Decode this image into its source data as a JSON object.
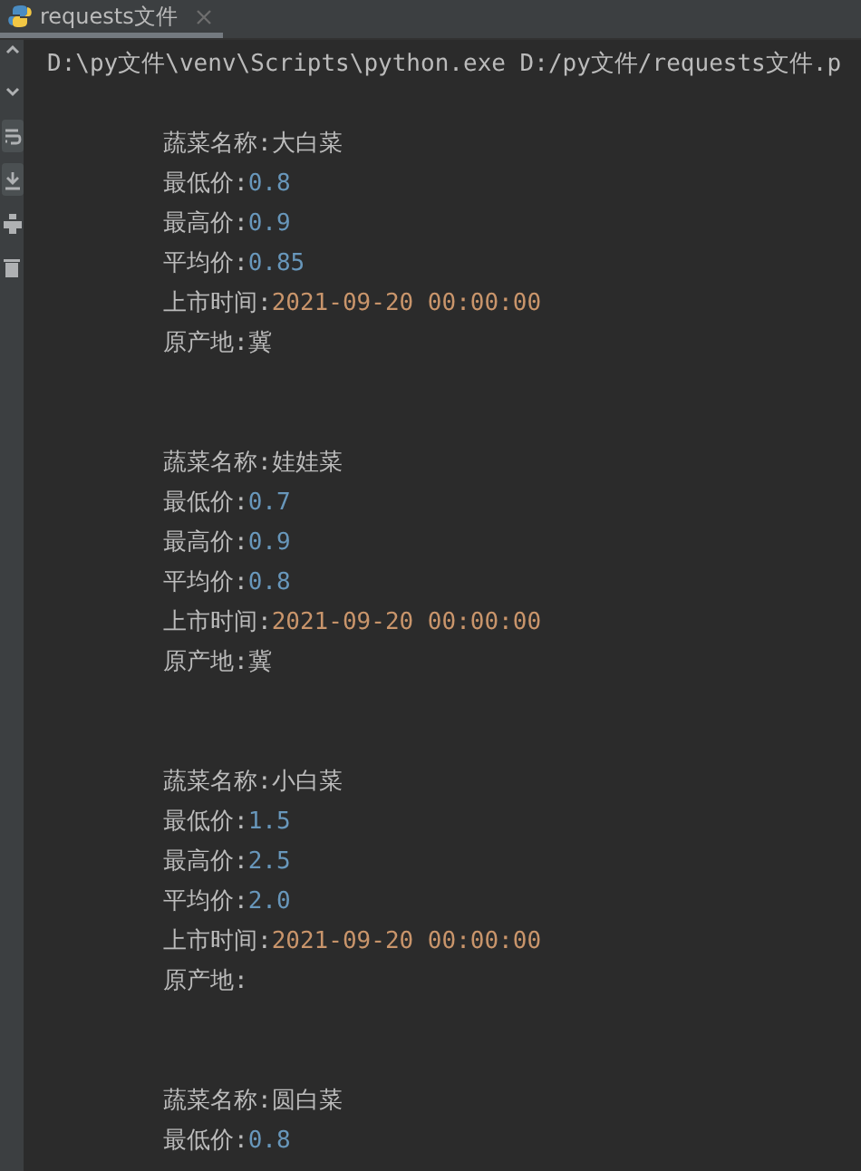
{
  "tab": {
    "title": "requests文件",
    "selected": true
  },
  "toolbar": [
    {
      "kind": "up",
      "on": false
    },
    {
      "kind": "down",
      "on": false
    },
    {
      "kind": "wrap",
      "on": true
    },
    {
      "kind": "scroll",
      "on": true
    },
    {
      "kind": "print",
      "on": false
    },
    {
      "kind": "trash",
      "on": false
    }
  ],
  "console": {
    "command": "D:\\py文件\\venv\\Scripts\\python.exe D:/py文件/requests文件.p",
    "records": [
      {
        "lines": [
          {
            "label": "蔬菜名称:",
            "value": "大白菜",
            "kind": "text"
          },
          {
            "label": "最低价:",
            "value": "0.8",
            "kind": "number"
          },
          {
            "label": "最高价:",
            "value": "0.9",
            "kind": "number"
          },
          {
            "label": "平均价:",
            "value": "0.85",
            "kind": "number"
          },
          {
            "label": "上市时间:",
            "value": "2021-09-20 00:00:00",
            "kind": "date"
          },
          {
            "label": "原产地:",
            "value": "冀",
            "kind": "text"
          }
        ]
      },
      {
        "lines": [
          {
            "label": "蔬菜名称:",
            "value": "娃娃菜",
            "kind": "text"
          },
          {
            "label": "最低价:",
            "value": "0.7",
            "kind": "number"
          },
          {
            "label": "最高价:",
            "value": "0.9",
            "kind": "number"
          },
          {
            "label": "平均价:",
            "value": "0.8",
            "kind": "number"
          },
          {
            "label": "上市时间:",
            "value": "2021-09-20 00:00:00",
            "kind": "date"
          },
          {
            "label": "原产地:",
            "value": "冀",
            "kind": "text"
          }
        ]
      },
      {
        "lines": [
          {
            "label": "蔬菜名称:",
            "value": "小白菜",
            "kind": "text"
          },
          {
            "label": "最低价:",
            "value": "1.5",
            "kind": "number"
          },
          {
            "label": "最高价:",
            "value": "2.5",
            "kind": "number"
          },
          {
            "label": "平均价:",
            "value": "2.0",
            "kind": "number"
          },
          {
            "label": "上市时间:",
            "value": "2021-09-20 00:00:00",
            "kind": "date"
          },
          {
            "label": "原产地:"
          }
        ]
      },
      {
        "lines": [
          {
            "label": "蔬菜名称:",
            "value": "圆白菜",
            "kind": "text"
          },
          {
            "label": "最低价:",
            "value": "0.8",
            "kind": "number"
          }
        ]
      }
    ]
  }
}
